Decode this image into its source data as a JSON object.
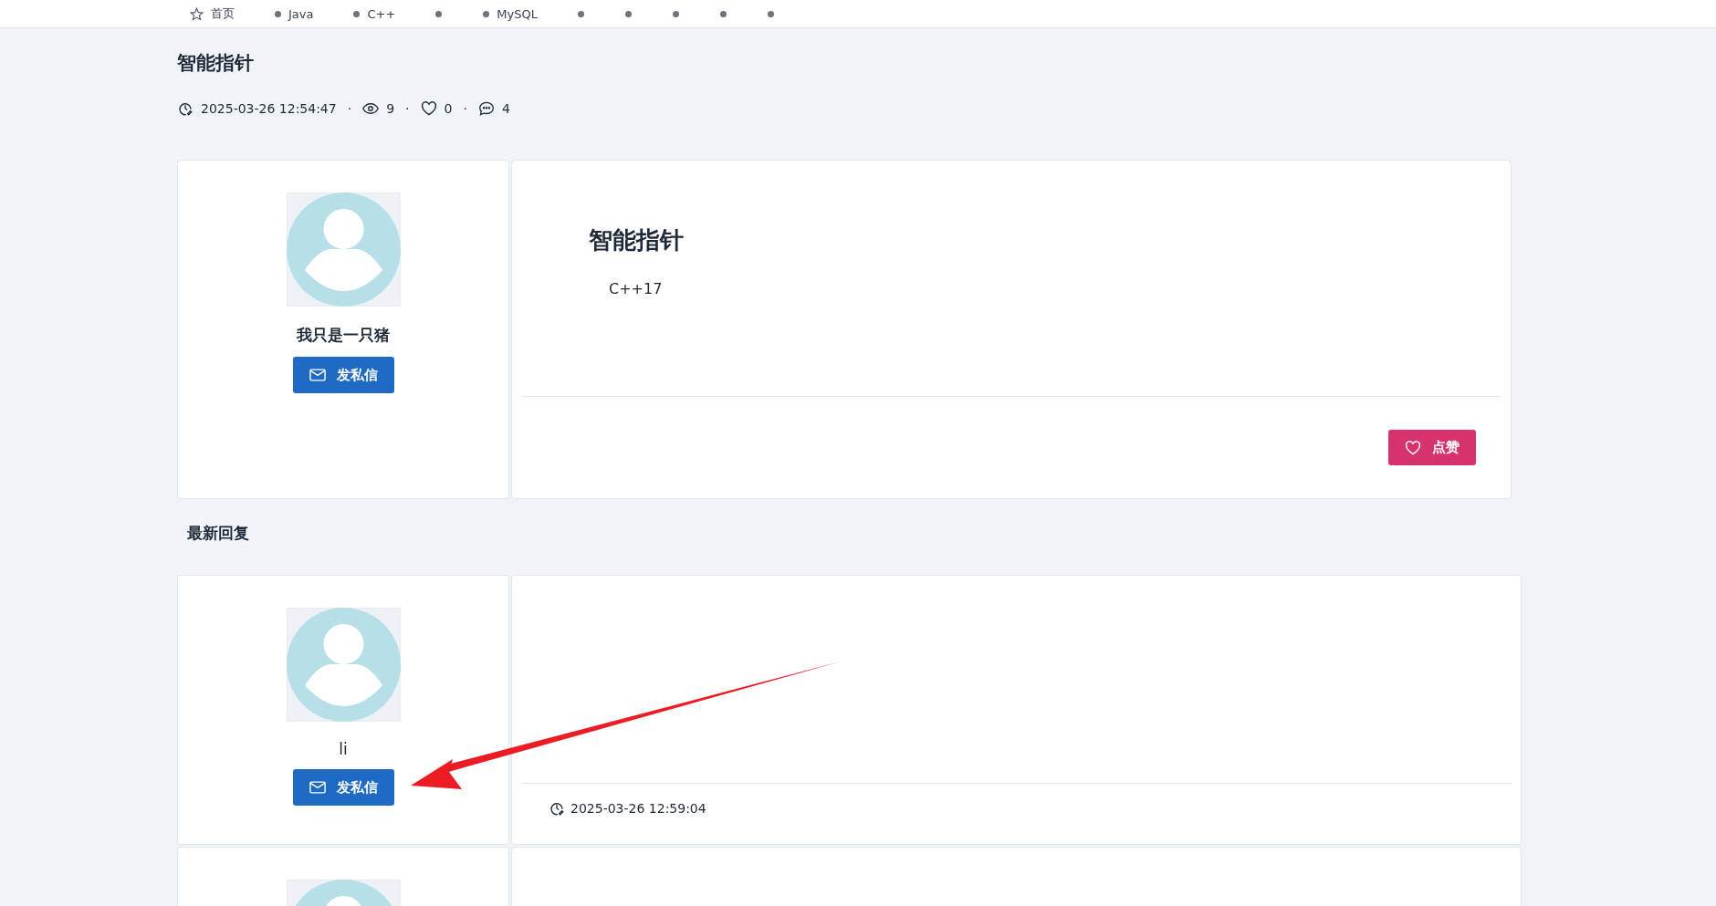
{
  "nav": [
    {
      "kind": "home",
      "label": "首页"
    },
    {
      "kind": "dot",
      "label": "Java"
    },
    {
      "kind": "dot",
      "label": "C++"
    },
    {
      "kind": "dot"
    },
    {
      "kind": "dot",
      "label": "MySQL"
    },
    {
      "kind": "dot"
    },
    {
      "kind": "dot"
    },
    {
      "kind": "dot"
    },
    {
      "kind": "dot"
    },
    {
      "kind": "dot"
    }
  ],
  "post": {
    "title": "智能指针",
    "meta": {
      "date": "2025-03-26 12:54:47",
      "views": "9",
      "likes": "0",
      "comments": "4",
      "separator": "·"
    },
    "author": {
      "name": "我只是一只猪",
      "bold": true,
      "message_button": "发私信"
    },
    "body_title": "智能指针",
    "content": "C++17",
    "like_button": "点赞"
  },
  "section_title": "最新回复",
  "replies": [
    {
      "kind": "reply",
      "author": {
        "name": "li",
        "bold": false,
        "message_button": "发私信"
      },
      "date": "2025-03-26 12:59:04"
    },
    {
      "kind": "cut"
    }
  ],
  "annotation": {
    "kind": "arrow"
  }
}
